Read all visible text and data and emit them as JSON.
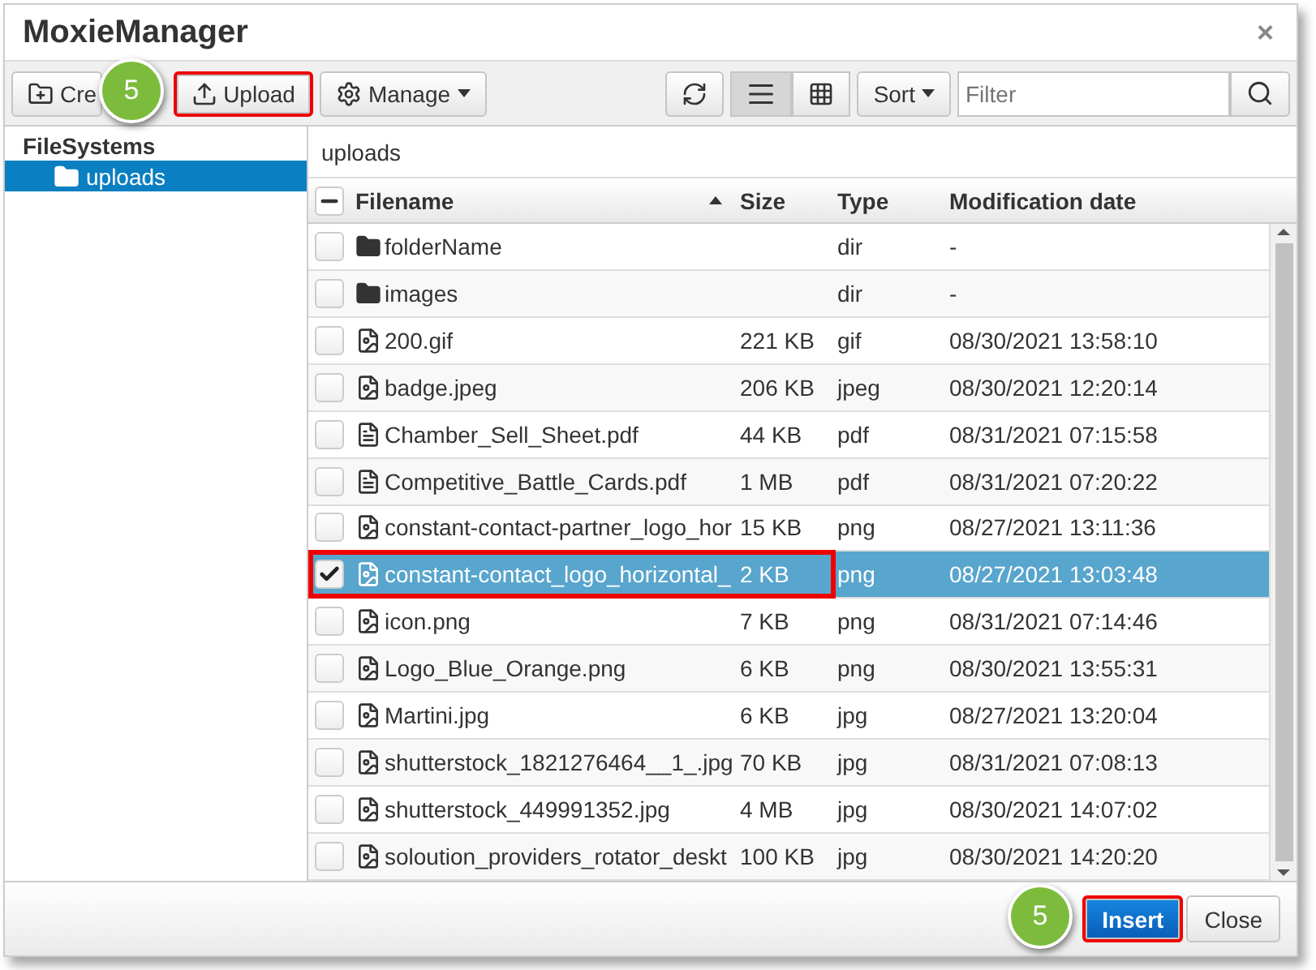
{
  "window": {
    "title": "MoxieManager",
    "close": "×"
  },
  "toolbar": {
    "buttons": [
      {
        "kind": "create",
        "label": "Cre",
        "highlighted": false,
        "badge": "5"
      },
      {
        "kind": "upload",
        "label": "Upload",
        "highlighted": true
      },
      {
        "kind": "manage",
        "label": "Manage",
        "highlighted": false
      }
    ],
    "view_modes": [
      {
        "kind": "list",
        "selected": true
      },
      {
        "kind": "grid",
        "selected": false
      }
    ],
    "sort": "Sort",
    "filter": {
      "placeholder": "Filter"
    }
  },
  "sidebar": {
    "title": "FileSystems",
    "items": [
      {
        "label": "uploads",
        "selected": true
      }
    ]
  },
  "path": "uploads",
  "table": {
    "select_all": {
      "indeterminate": true
    },
    "columns": [
      {
        "label": "Filename",
        "sorted": true
      },
      {
        "label": "Size",
        "sorted": false
      },
      {
        "label": "Type",
        "sorted": false
      },
      {
        "label": "Modification date",
        "sorted": false
      }
    ],
    "rows": [
      {
        "kind": "folder",
        "name": "folderName",
        "size": "",
        "type": "dir",
        "date": "-",
        "checked": false,
        "selected": false,
        "highlighted": false
      },
      {
        "kind": "folder",
        "name": "images",
        "size": "",
        "type": "dir",
        "date": "-",
        "checked": false,
        "selected": false,
        "highlighted": false
      },
      {
        "kind": "image",
        "name": "200.gif",
        "size": "221 KB",
        "type": "gif",
        "date": "08/30/2021 13:58:10",
        "checked": false,
        "selected": false,
        "highlighted": false
      },
      {
        "kind": "image",
        "name": "badge.jpeg",
        "size": "206 KB",
        "type": "jpeg",
        "date": "08/30/2021 12:20:14",
        "checked": false,
        "selected": false,
        "highlighted": false
      },
      {
        "kind": "pdf",
        "name": "Chamber_Sell_Sheet.pdf",
        "size": "44 KB",
        "type": "pdf",
        "date": "08/31/2021 07:15:58",
        "checked": false,
        "selected": false,
        "highlighted": false
      },
      {
        "kind": "pdf",
        "name": "Competitive_Battle_Cards.pdf",
        "size": "1 MB",
        "type": "pdf",
        "date": "08/31/2021 07:20:22",
        "checked": false,
        "selected": false,
        "highlighted": false
      },
      {
        "kind": "image",
        "name": "constant-contact-partner_logo_hor",
        "size": "15 KB",
        "type": "png",
        "date": "08/27/2021 13:11:36",
        "checked": false,
        "selected": false,
        "highlighted": false
      },
      {
        "kind": "image",
        "name": "constant-contact_logo_horizontal_",
        "size": "2 KB",
        "type": "png",
        "date": "08/27/2021 13:03:48",
        "checked": true,
        "selected": true,
        "highlighted": true
      },
      {
        "kind": "image",
        "name": "icon.png",
        "size": "7 KB",
        "type": "png",
        "date": "08/31/2021 07:14:46",
        "checked": false,
        "selected": false,
        "highlighted": false
      },
      {
        "kind": "image",
        "name": "Logo_Blue_Orange.png",
        "size": "6 KB",
        "type": "png",
        "date": "08/30/2021 13:55:31",
        "checked": false,
        "selected": false,
        "highlighted": false
      },
      {
        "kind": "image",
        "name": "Martini.jpg",
        "size": "6 KB",
        "type": "jpg",
        "date": "08/27/2021 13:20:04",
        "checked": false,
        "selected": false,
        "highlighted": false
      },
      {
        "kind": "image",
        "name": "shutterstock_1821276464__1_.jpg",
        "size": "70 KB",
        "type": "jpg",
        "date": "08/31/2021 07:08:13",
        "checked": false,
        "selected": false,
        "highlighted": false
      },
      {
        "kind": "image",
        "name": "shutterstock_449991352.jpg",
        "size": "4 MB",
        "type": "jpg",
        "date": "08/30/2021 14:07:02",
        "checked": false,
        "selected": false,
        "highlighted": false
      },
      {
        "kind": "image",
        "name": "soloution_providers_rotator_deskt",
        "size": "100 KB",
        "type": "jpg",
        "date": "08/30/2021 14:20:20",
        "checked": false,
        "selected": false,
        "highlighted": false
      }
    ]
  },
  "footer": {
    "badge": "5",
    "buttons": [
      {
        "kind": "primary",
        "label": "Insert",
        "highlighted": true
      },
      {
        "kind": "default",
        "label": "Close",
        "highlighted": false
      }
    ]
  }
}
